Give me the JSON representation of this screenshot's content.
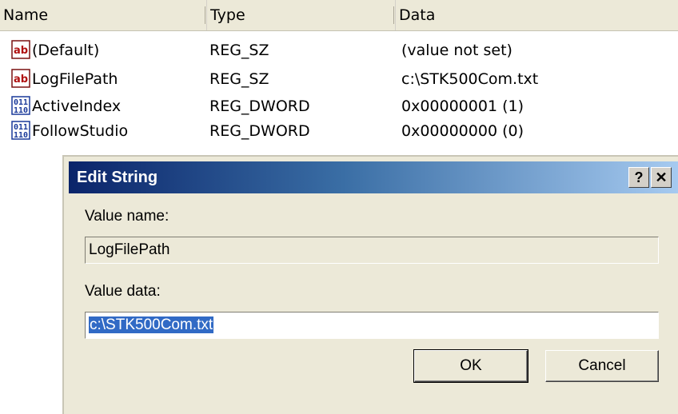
{
  "columns": {
    "name": "Name",
    "type": "Type",
    "data": "Data"
  },
  "rows": [
    {
      "icon": "string-value-icon",
      "name": "(Default)",
      "type": "REG_SZ",
      "data": "(value not set)"
    },
    {
      "icon": "string-value-icon",
      "name": "LogFilePath",
      "type": "REG_SZ",
      "data": "c:\\STK500Com.txt"
    },
    {
      "icon": "binary-value-icon",
      "name": "ActiveIndex",
      "type": "REG_DWORD",
      "data": "0x00000001 (1)"
    },
    {
      "icon": "binary-value-icon",
      "name": "FollowStudio",
      "type": "REG_DWORD",
      "data": "0x00000000 (0)"
    }
  ],
  "dialog": {
    "title": "Edit String",
    "help_label": "?",
    "close_label": "✕",
    "value_name_label": "Value name:",
    "value_name": "LogFilePath",
    "value_data_label": "Value data:",
    "value_data": "c:\\STK500Com.txt",
    "ok_label": "OK",
    "cancel_label": "Cancel"
  },
  "colors": {
    "title_start": "#0a246a",
    "title_end": "#a6caf0",
    "selection": "#316ac5",
    "dialog_bg": "#ece9d8"
  }
}
